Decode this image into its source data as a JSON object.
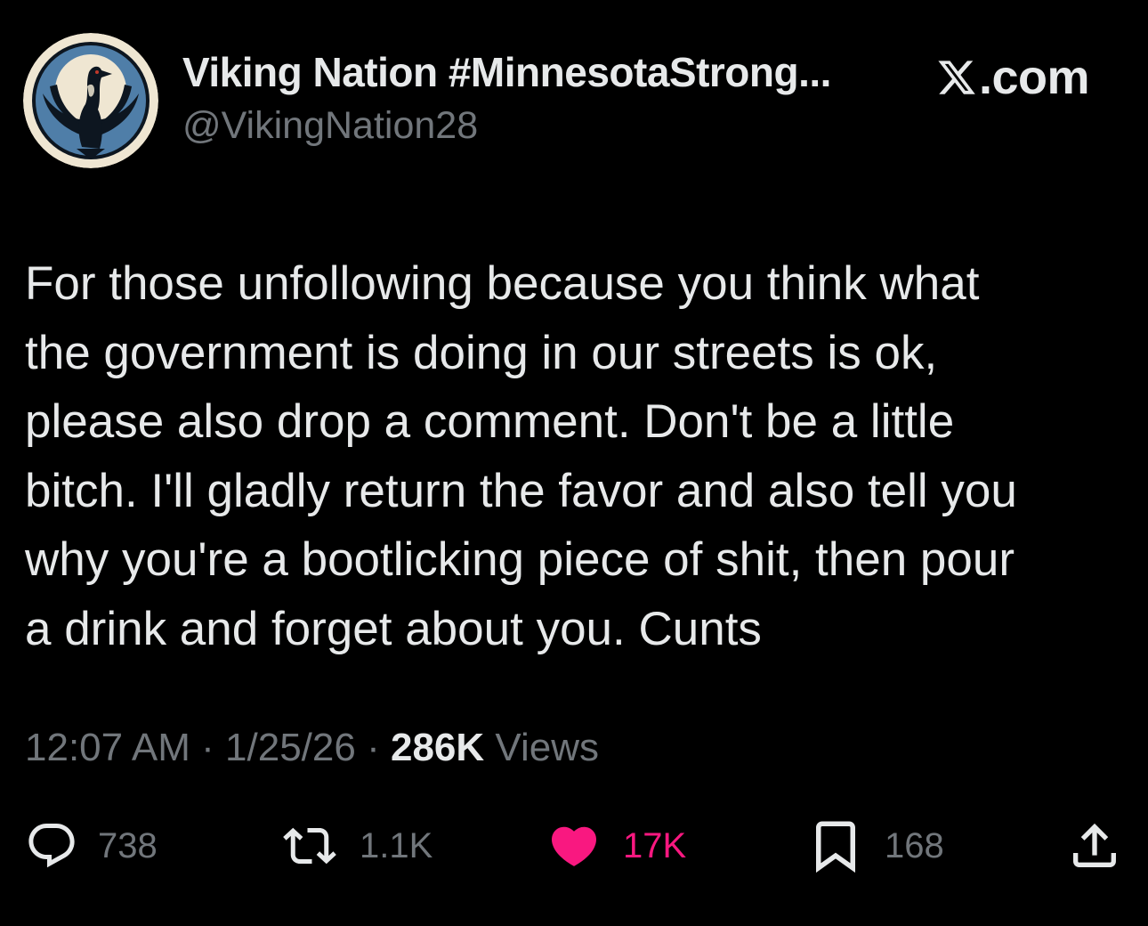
{
  "author": {
    "display_name": "Viking Nation #MinnesotaStrong...",
    "handle": "@VikingNation28",
    "avatar_icon": "loon-bird-logo"
  },
  "site": {
    "label": ".com",
    "icon": "x-logo-icon"
  },
  "tweet": {
    "lines": [
      "For those unfollowing because you think what",
      "the government is doing in our streets is ok,",
      "please also drop a comment. Don't be a little",
      "bitch. I'll gladly return the favor and also tell you",
      "why you're a bootlicking piece of shit, then pour",
      "a drink and forget about you. Cunts"
    ]
  },
  "meta": {
    "time": "12:07 AM",
    "date": "1/25/26",
    "separator": "·",
    "views_count": "286K",
    "views_label": "Views"
  },
  "actions": {
    "replies": "738",
    "reposts": "1.1K",
    "likes": "17K",
    "bookmarks": "168"
  },
  "colors": {
    "background": "#000000",
    "text_primary": "#e7e9ea",
    "text_secondary": "#71767b",
    "like_pink": "#f91880",
    "avatar_ring": "#efe6d2",
    "avatar_blue": "#4f7ea8"
  }
}
